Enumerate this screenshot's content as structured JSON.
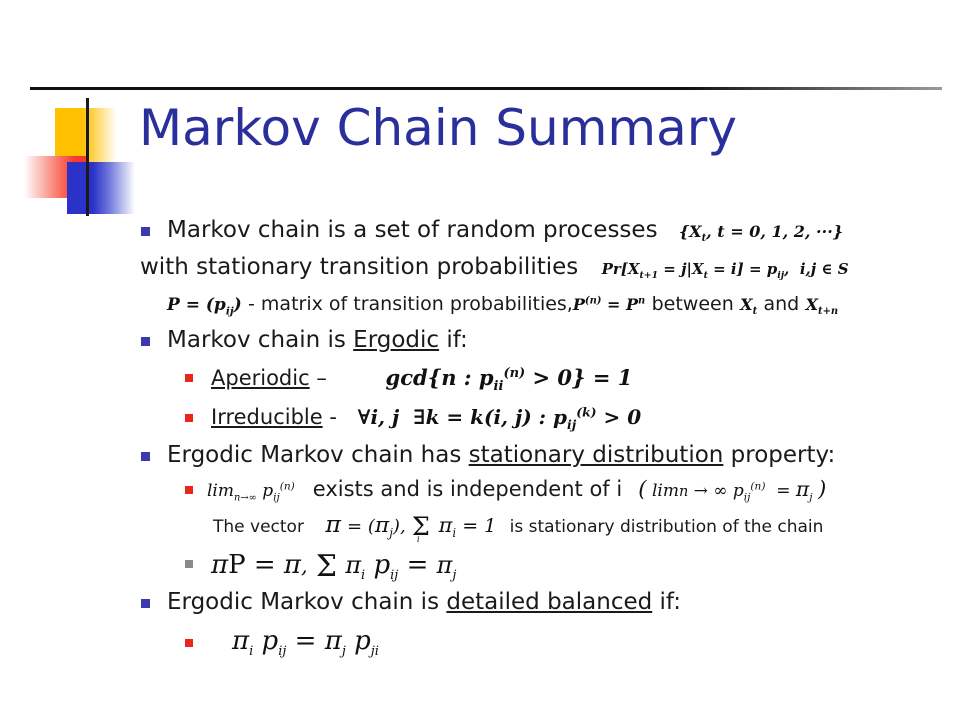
{
  "slide": {
    "title": "Markov Chain Summary",
    "colors": {
      "title": "#2A2F9B",
      "bullet_level1": "#3A3AAE",
      "bullet_level2": "#E8261C",
      "logo_yellow": "#FFC000",
      "logo_red": "#F83A2B",
      "logo_blue": "#2A32C8",
      "rule": "#111111"
    },
    "logo": {
      "name": "powerpoint-decorative-logo",
      "shapes": [
        "yellow-square",
        "red-square",
        "blue-square",
        "vertical-rule",
        "horizontal-rule"
      ]
    },
    "lines": [
      {
        "id": "line1",
        "level": 1,
        "bullet": "blue-square",
        "text": "Markov chain is a set of random processes",
        "formula": "{X_t, t = 0, 1, 2, ···}"
      },
      {
        "id": "line2",
        "level": 1,
        "bullet": "none",
        "text": "with stationary transition probabilities",
        "formula": "Pr[X_t+1 = j|X_t = i] = p_ij,  i, j ∈ S"
      },
      {
        "id": "line3",
        "level": 1,
        "bullet": "none",
        "formula_lead": "P = (p_ij)",
        "text": "- matrix of transition probabilities,",
        "formula_mid": "P^(n) = P^n",
        "text2": "between",
        "formula_a": "X_t",
        "text3": "and",
        "formula_b": "X_t+n"
      },
      {
        "id": "line4",
        "level": 1,
        "bullet": "blue-square",
        "text_before": "Markov chain is ",
        "text_underlined": "Ergodic",
        "text_after": " if:"
      },
      {
        "id": "line5",
        "level": 2,
        "bullet": "red-square",
        "text_underlined": "Aperiodic",
        "text_after": " –",
        "formula": "gcd{n : p_ii^(n) > 0} = 1"
      },
      {
        "id": "line6",
        "level": 2,
        "bullet": "red-square",
        "text_underlined": "Irreducible",
        "text_after": " -",
        "formula": "∀i, j ∃k = k(i, j) : p_ij^(k) > 0"
      },
      {
        "id": "line7",
        "level": 1,
        "bullet": "blue-square",
        "text_before": "Ergodic Markov chain has ",
        "text_underlined": "stationary distribution",
        "text_after": " property:"
      },
      {
        "id": "line8",
        "level": 2,
        "bullet": "red-square",
        "formula_lead": "limₙ→∞ p_ij^(n)",
        "text": "exists and is independent of i",
        "formula_paren": "( lim n → ∞ p_ij^(n) = π_j )"
      },
      {
        "id": "line9",
        "level": 3,
        "bullet": "none",
        "text_before": "The vector",
        "formula": "π = (π_j), Σ_i π_i = 1",
        "text_after": "is stationary distribution of the chain"
      },
      {
        "id": "line10",
        "level": 2,
        "bullet": "gray-square",
        "formula": "πP = π,  Σ π_i p_ij = π_j"
      },
      {
        "id": "line11",
        "level": 1,
        "bullet": "blue-square",
        "text_before": "Ergodic Markov chain is ",
        "text_underlined": "detailed balanced",
        "text_after": " if:"
      },
      {
        "id": "line12",
        "level": 2,
        "bullet": "gray-square",
        "formula": "π_i p_ij = π_j p_ji"
      }
    ]
  }
}
